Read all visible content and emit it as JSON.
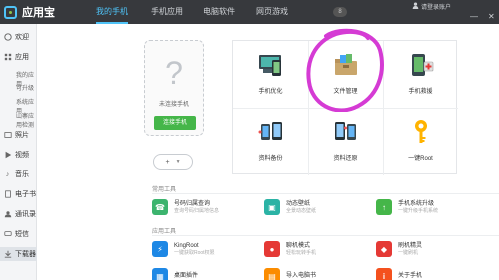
{
  "app": {
    "title": "应用宝"
  },
  "colors": {
    "topbar": "#37393d",
    "accent": "#4fc3f7",
    "green": "#45b649",
    "scribble": "#d53bd4"
  },
  "nav": {
    "tabs": [
      {
        "label": "我的手机",
        "active": true
      },
      {
        "label": "手机应用"
      },
      {
        "label": "电脑软件"
      },
      {
        "label": "网页游戏"
      }
    ],
    "badge": "8",
    "login": "请登录账户",
    "minimize": "—",
    "close": "✕"
  },
  "sidebar": {
    "items": [
      {
        "label": "欢迎",
        "icon": "home-icon"
      },
      {
        "label": "应用",
        "icon": "apps-icon"
      },
      {
        "label": "照片",
        "icon": "photo-icon"
      },
      {
        "label": "视频",
        "icon": "video-icon"
      },
      {
        "label": "音乐",
        "icon": "music-icon"
      },
      {
        "label": "电子书",
        "icon": "book-icon"
      },
      {
        "label": "通讯录",
        "icon": "contacts-icon"
      },
      {
        "label": "短信",
        "icon": "sms-icon"
      },
      {
        "label": "下载器",
        "icon": "download-icon"
      }
    ],
    "app_subitems": [
      "我的应用",
      "可升级",
      "系统应用",
      "山寨应用检测"
    ]
  },
  "device": {
    "placeholder": "?",
    "status": "未连接手机",
    "connect_label": "连接手机",
    "add_label": "+"
  },
  "tools": [
    {
      "label": "手机优化",
      "icon": "optimize-icon"
    },
    {
      "label": "文件管理",
      "icon": "folder-icon"
    },
    {
      "label": "手机救援",
      "icon": "rescue-icon"
    },
    {
      "label": "资料备份",
      "icon": "backup-icon"
    },
    {
      "label": "资料还原",
      "icon": "restore-icon"
    },
    {
      "label": "一键Root",
      "icon": "key-icon"
    }
  ],
  "common_tools": {
    "title": "常用工具",
    "items": [
      {
        "name": "号码归属查询",
        "desc": "查询号码归属地信息",
        "icon": "phone-icon",
        "color": "#3cb46e"
      },
      {
        "name": "动态壁纸",
        "desc": "全景动态壁纸",
        "icon": "wallpaper-icon",
        "color": "#2bb3a5"
      },
      {
        "name": "手机系统升级",
        "desc": "一键升级手机系统",
        "icon": "upgrade-icon",
        "color": "#45b649"
      }
    ]
  },
  "app_tools": {
    "title": "应用工具",
    "items": [
      {
        "name": "KingRoot",
        "desc": "一键获取Root权限",
        "icon": "kingroot-icon",
        "color": "#1e88e5"
      },
      {
        "name": "聊机模式",
        "desc": "轻松玩转手机",
        "icon": "chat-mode-icon",
        "color": "#e53935"
      },
      {
        "name": "刷机精灵",
        "desc": "一键刷机",
        "icon": "flash-icon",
        "color": "#e53935"
      }
    ]
  },
  "more_tools": [
    {
      "name": "桌面插件",
      "icon": "widget-icon",
      "color": "#1e88e5"
    },
    {
      "name": "导入电脑书",
      "icon": "import-icon",
      "color": "#fb8c00"
    },
    {
      "name": "关于手机",
      "icon": "about-icon",
      "color": "#f4511e"
    }
  ]
}
